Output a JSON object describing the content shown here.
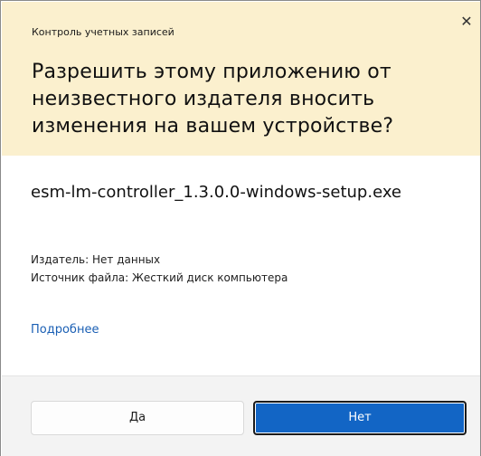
{
  "dialog": {
    "caption": "Контроль учетных записей",
    "close_glyph": "✕",
    "question": "Разрешить этому приложению от неизвестного издателя вносить изменения на вашем устройстве?",
    "filename": "esm-lm-controller_1.3.0.0-windows-setup.exe",
    "publisher": "Издатель: Нет данных",
    "source": "Источник файла: Жесткий диск компьютера",
    "more_link": "Подробнее",
    "yes_label": "Да",
    "no_label": "Нет"
  },
  "colors": {
    "header_bg": "#fbf0ce",
    "link": "#1a5fb4",
    "primary_button": "#1265c5",
    "footer_bg": "#f3f3f3"
  }
}
